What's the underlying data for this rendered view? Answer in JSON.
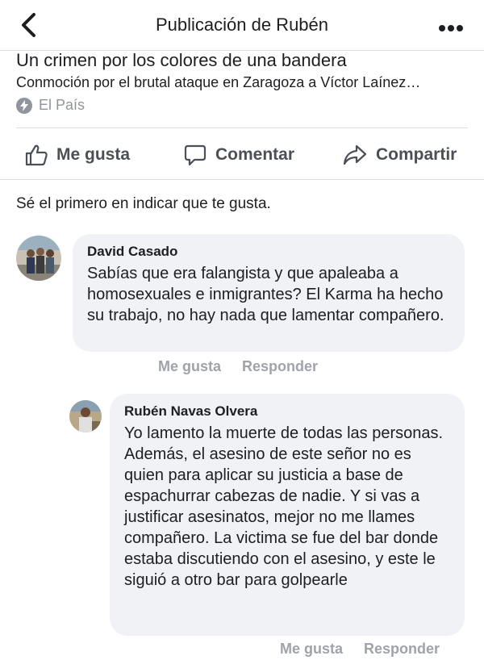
{
  "header": {
    "title": "Publicación de Rubén"
  },
  "link": {
    "title": "Un crimen por los colores de una bandera",
    "subtitle": "Conmoción por el brutal ataque en Zaragoza a Víctor Laínez…",
    "source": "El País"
  },
  "actions": {
    "like": "Me gusta",
    "comment": "Comentar",
    "share": "Compartir"
  },
  "likes_prompt": "Sé el primero en indicar que te gusta.",
  "comments": [
    {
      "author": "David Casado",
      "text": "Sabías que era falangista y que apaleaba a homosexuales e inmigrantes? El Karma ha hecho su trabajo, no hay nada que lamentar compañero.",
      "like": "Me gusta",
      "reply": "Responder"
    },
    {
      "author": "Rubén Navas Olvera",
      "text": "Yo lamento la muerte de todas las personas. Además, el asesino de este señor no es quien para aplicar su justicia a base de espachurrar cabezas de nadie. Y si vas a justificar asesinatos, mejor no me llames compañero. La victima se fue del bar donde estaba discutiendo con el asesino, y este le siguió a otro bar para golpearle",
      "like": "Me gusta",
      "reply": "Responder"
    }
  ]
}
